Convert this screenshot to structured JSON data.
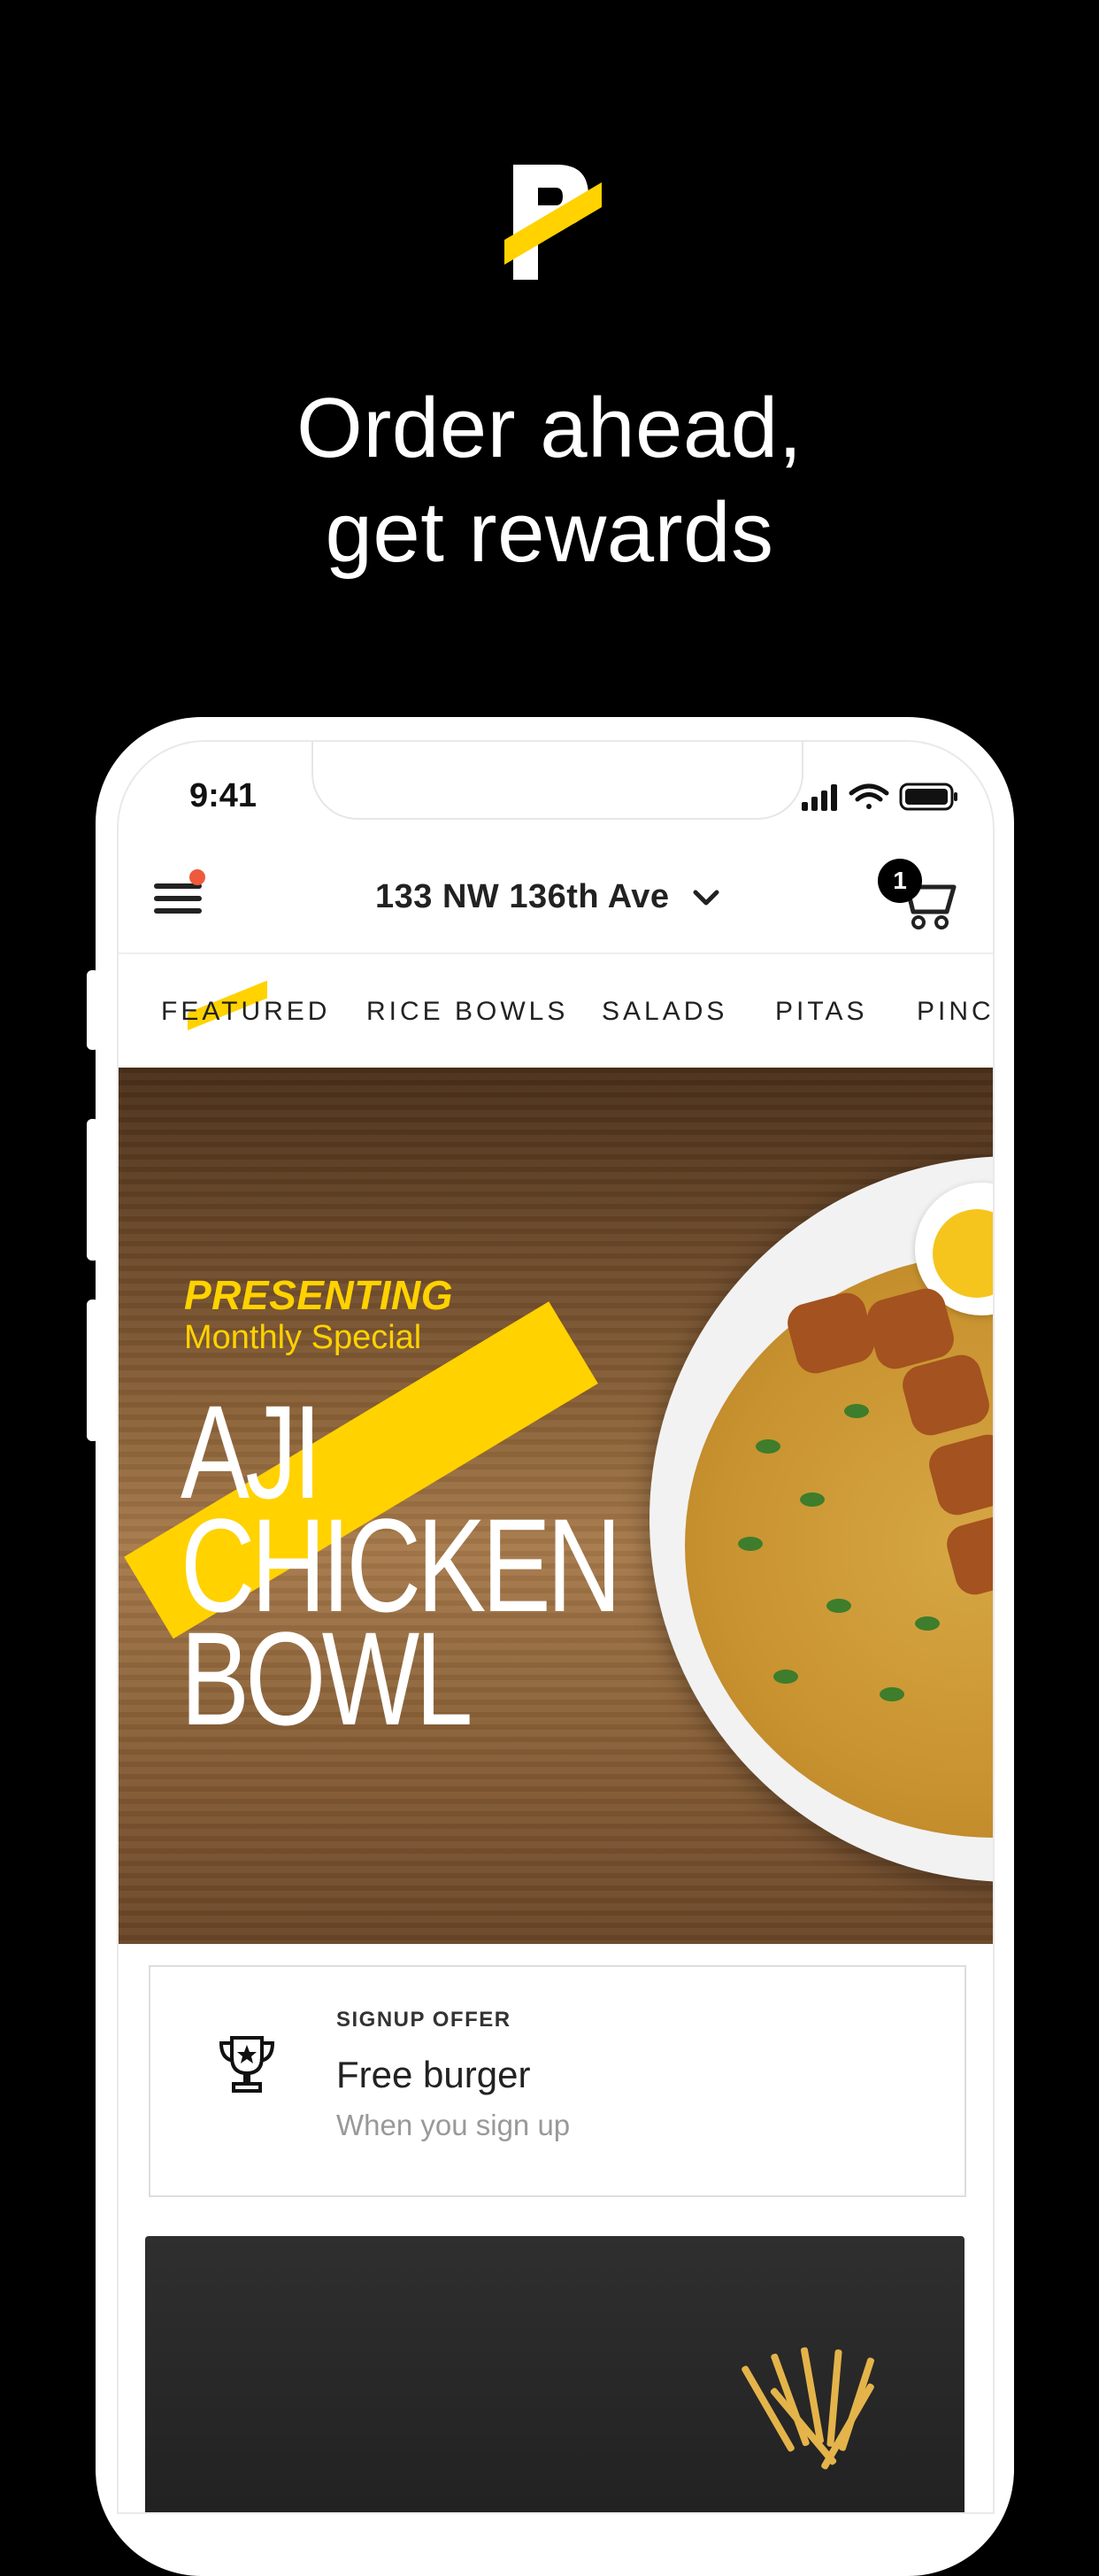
{
  "marketing": {
    "logo": "P",
    "headline_line1": "Order ahead,",
    "headline_line2": "get rewards"
  },
  "status_bar": {
    "time": "9:41",
    "icons": [
      "signal-icon",
      "wifi-icon",
      "battery-icon"
    ]
  },
  "header": {
    "address": "133 NW 136th Ave",
    "cart_count": "1",
    "colors": {
      "notification_dot": "#ef5a3c",
      "accent": "#ffd200"
    }
  },
  "tabs": [
    {
      "label": "FEATURED",
      "active": true
    },
    {
      "label": "RICE BOWLS"
    },
    {
      "label": "SALADS"
    },
    {
      "label": "PITAS"
    },
    {
      "label": "PINCH"
    }
  ],
  "hero": {
    "kicker": "PRESENTING",
    "subkicker": "Monthly Special",
    "title_line1": "AJI",
    "title_line2": "CHICKEN",
    "title_line3": "BOWL"
  },
  "offer": {
    "kicker": "SIGNUP OFFER",
    "title": "Free burger",
    "subtitle": "When you sign up",
    "icon": "trophy-icon"
  }
}
